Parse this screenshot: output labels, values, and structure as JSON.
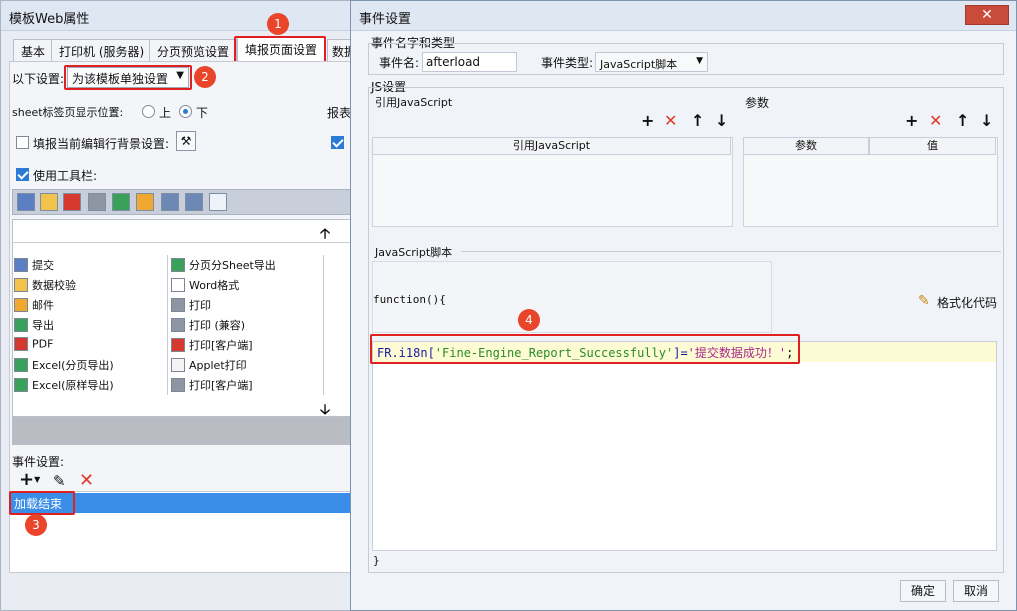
{
  "left": {
    "title": "模板Web属性",
    "tabs": [
      "基本",
      "打印机 (服务器)",
      "分页预览设置",
      "填报页面设置",
      "数据"
    ],
    "settings_label": "以下设置:",
    "settings_select": "为该模板单独设置",
    "sheet_pos_label": "sheet标签页显示位置:",
    "radio_up": "上",
    "radio_down": "下",
    "report_truncated": "报表",
    "bg_setting_label": "填报当前编辑行背景设置:",
    "use_toolbar_label": "使用工具栏:",
    "toolbar_items_col1": [
      "提交",
      "数据校验",
      "邮件",
      "导出",
      "PDF",
      "Excel(分页导出)",
      "Excel(原样导出)"
    ],
    "toolbar_items_col2": [
      "分页分Sheet导出",
      "Word格式",
      "打印",
      "打印 (兼容)",
      "打印[客户端]",
      "Applet打印",
      "打印[客户端]"
    ],
    "event_settings_label": "事件设置:",
    "event_item": "加载结束"
  },
  "right": {
    "title": "事件设置",
    "name_group_label": "事件名字和类型",
    "event_name_label": "事件名:",
    "event_name_value": "afterload",
    "event_type_label": "事件类型:",
    "event_type_value": "JavaScript脚本",
    "js_group_label": "JS设置",
    "ref_js_label": "引用JavaScript",
    "params_label": "参数",
    "ref_js_col": "引用JavaScript",
    "param_col": "参数",
    "value_col": "值",
    "script_label": "JavaScript脚本",
    "function_open": "function(){",
    "format_label": "格式化代码",
    "code_prefix": "FR.i18n[",
    "code_key": "'Fine-Engine_Report_Successfully'",
    "code_mid": "]=",
    "code_value": "'提交数据成功！'",
    "code_end": ";",
    "function_close": "}",
    "ok_label": "确定",
    "cancel_label": "取消"
  },
  "badges": [
    "1",
    "2",
    "3",
    "4"
  ]
}
